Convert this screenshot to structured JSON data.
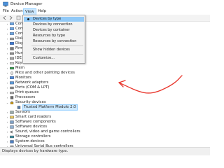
{
  "window": {
    "title": "Device Manager",
    "icon": "device-manager-icon"
  },
  "menu": {
    "file": "File",
    "action": "Action",
    "view": "View",
    "help": "Help"
  },
  "toolbar": {
    "buttons": [
      "back-icon",
      "forward-icon",
      "properties-icon",
      "help-icon"
    ]
  },
  "view_menu": {
    "items": [
      {
        "label": "Devices by type",
        "checked": true,
        "highlighted": true
      },
      {
        "label": "Devices by connection"
      },
      {
        "label": "Devices by container"
      },
      {
        "label": "Resources by type"
      },
      {
        "label": "Resources by connection"
      },
      {
        "label": "Show hidden devices"
      },
      {
        "label": "Customize..."
      }
    ]
  },
  "tree": {
    "rows": [
      {
        "label": "Com",
        "icon": "computer-icon"
      },
      {
        "label": "Com",
        "icon": "computer-icon"
      },
      {
        "label": "Com",
        "icon": "computer-icon"
      },
      {
        "label": "Disk",
        "icon": "disk-icon"
      },
      {
        "label": "Displ",
        "icon": "display-icon"
      },
      {
        "label": "Firm",
        "icon": "firmware-icon"
      },
      {
        "label": "Hum",
        "icon": "hid-icon"
      },
      {
        "label": "IDE",
        "icon": "ide-icon"
      },
      {
        "label": "Keyb",
        "icon": "keyboard-icon"
      },
      {
        "label": "Mem",
        "icon": "memory-icon"
      },
      {
        "label": "Mice and other pointing devices",
        "icon": "mouse-icon"
      },
      {
        "label": "Monitors",
        "icon": "monitor-icon"
      },
      {
        "label": "Network adapters",
        "icon": "network-icon"
      },
      {
        "label": "Ports (COM & LPT)",
        "icon": "port-icon"
      },
      {
        "label": "Print queues",
        "icon": "printer-icon"
      },
      {
        "label": "Processors",
        "icon": "processor-icon"
      },
      {
        "label": "Security devices",
        "icon": "security-icon",
        "expanded": true
      },
      {
        "label": "Trusted Platform Module 2.0",
        "icon": "tpm-icon",
        "child": true,
        "selected": true
      },
      {
        "label": "Sensors",
        "icon": "sensor-icon"
      },
      {
        "label": "Smart card readers",
        "icon": "smartcard-icon"
      },
      {
        "label": "Software components",
        "icon": "component-icon"
      },
      {
        "label": "Software devices",
        "icon": "software-icon"
      },
      {
        "label": "Sound, video and game controllers",
        "icon": "sound-icon"
      },
      {
        "label": "Storage controllers",
        "icon": "storage-icon"
      },
      {
        "label": "System devices",
        "icon": "system-icon"
      },
      {
        "label": "Universal Serial Bus controllers",
        "icon": "usb-icon"
      },
      {
        "label": "USB Connector Managers",
        "icon": "usb-icon"
      }
    ]
  },
  "status": {
    "text": "Displays devices by hardware type."
  },
  "colors": {
    "menu_highlight": "#cce8ff",
    "dropdown_highlight": "#91c9f7",
    "annotation": "#e8342a"
  }
}
